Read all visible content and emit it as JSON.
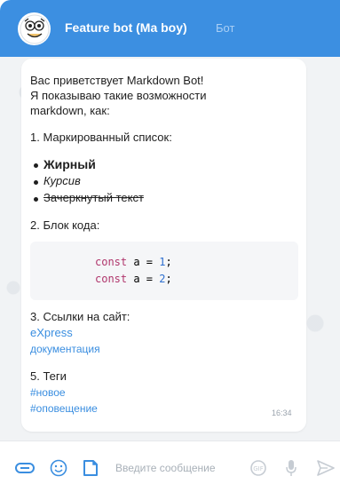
{
  "header": {
    "title": "Feature bot (Ma boy)",
    "badge": "Бот"
  },
  "message": {
    "intro_line1": "Вас приветствует Markdown Bot!",
    "intro_line2": "Я показываю такие возможности",
    "intro_line3": "markdown, как:",
    "section1_title": "1. Маркированный список:",
    "bullets": {
      "bold": "Жирный",
      "italic": "Курсив",
      "strike": "Зачеркнутый текст"
    },
    "section2_title": "2. Блок кода:",
    "code": {
      "line1": {
        "keyword": "const",
        "rest": " a = ",
        "number": "1",
        "end": ";"
      },
      "line2": {
        "keyword": "const",
        "rest": " a = ",
        "number": "2",
        "end": ";"
      }
    },
    "section3_title": "3. Ссылки на сайт:",
    "links": [
      "eXpress",
      "документация"
    ],
    "section5_title": "5. Теги",
    "tags": [
      "#новое",
      "#оповещение"
    ],
    "time": "16:34"
  },
  "composer": {
    "placeholder": "Введите сообщение"
  },
  "icons": {
    "avatar": "bot-avatar-icon",
    "attach": "attach-icon",
    "emoji": "emoji-icon",
    "sticker": "sticker-icon",
    "gif": "gif-icon",
    "mic": "microphone-icon",
    "send": "send-icon"
  },
  "colors": {
    "header": "#3c8fe1",
    "link": "#3a8ee0",
    "chat_bg": "#f1f3f5"
  }
}
